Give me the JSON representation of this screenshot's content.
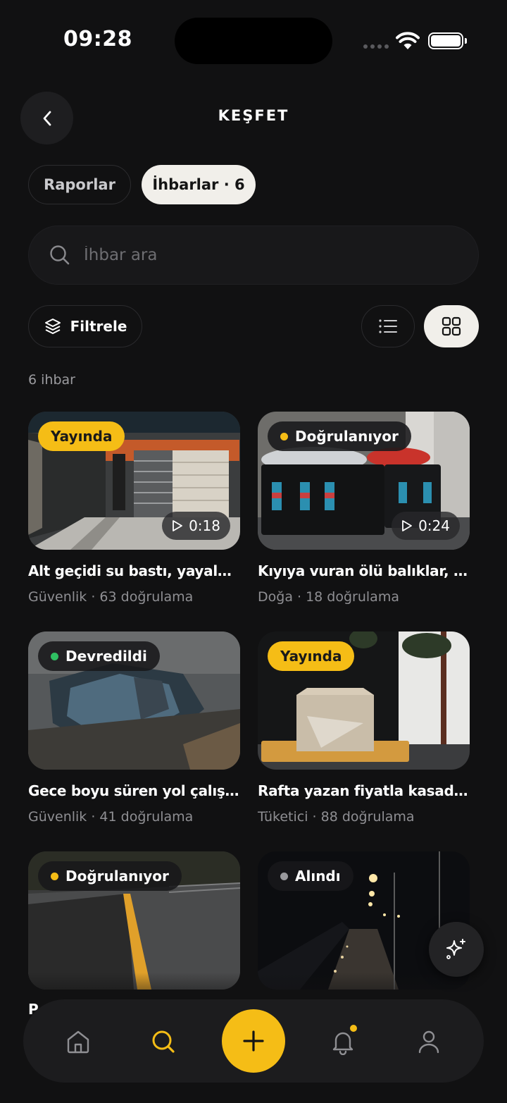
{
  "status_bar": {
    "time": "09:28"
  },
  "header": {
    "title": "KEŞFET"
  },
  "tabs": [
    {
      "label": "Raporlar",
      "active": false
    },
    {
      "label": "İhbarlar · 6",
      "active": true
    }
  ],
  "search": {
    "placeholder": "İhbar ara",
    "value": ""
  },
  "filters": {
    "filter_label": "Filtrele",
    "view_mode": "grid"
  },
  "result_count": "6 ihbar",
  "colors": {
    "accent": "#f5bd16",
    "background": "#111112",
    "status_green": "#2fbf62",
    "status_yellow": "#f5bd16",
    "status_gray": "#9a9a9e"
  },
  "cards": [
    {
      "status": "Yayında",
      "status_style": "live",
      "duration": "0:18",
      "title": "Alt geçidi su bastı, yayalar…",
      "meta": "Güvenlik · 63 doğrulama"
    },
    {
      "status": "Doğrulanıyor",
      "status_style": "dot-yellow",
      "duration": "0:24",
      "title": "Kıyıya vuran ölü balıklar, ko…",
      "meta": "Doğa · 18 doğrulama"
    },
    {
      "status": "Devredildi",
      "status_style": "dot-green",
      "duration": "",
      "title": "Gece boyu süren yol çalışm…",
      "meta": "Güvenlik · 41 doğrulama"
    },
    {
      "status": "Yayında",
      "status_style": "live",
      "duration": "",
      "title": "Rafta yazan fiyatla kasada…",
      "meta": "Tüketici · 88 doğrulama"
    },
    {
      "status": "Doğrulanıyor",
      "status_style": "dot-yellow",
      "duration": "",
      "title": "",
      "meta": ""
    },
    {
      "status": "Alındı",
      "status_style": "dot-gray",
      "duration": "",
      "title": "",
      "meta": ""
    }
  ],
  "peek_text": "P",
  "bottom_nav": [
    {
      "name": "home-icon",
      "active": false
    },
    {
      "name": "search-icon",
      "active": true
    },
    {
      "name": "add-icon",
      "active": false
    },
    {
      "name": "bell-icon",
      "active": false,
      "badge": true
    },
    {
      "name": "profile-icon",
      "active": false
    }
  ]
}
